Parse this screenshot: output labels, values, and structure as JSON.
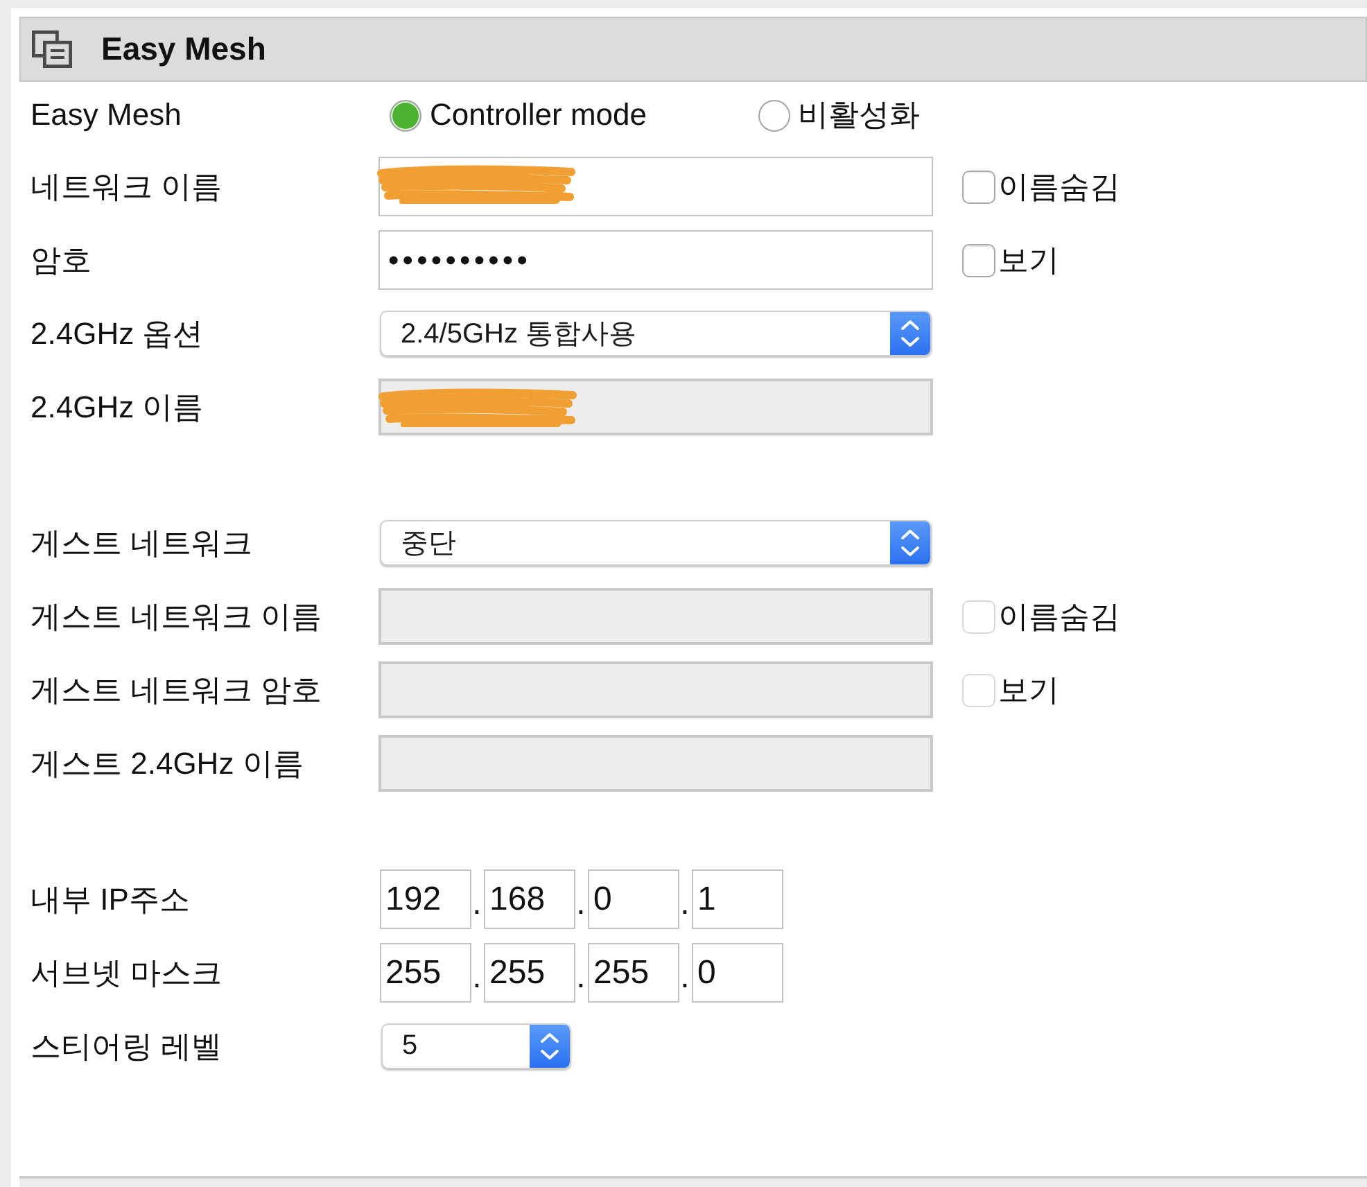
{
  "panel": {
    "title": "Easy Mesh"
  },
  "sections": [
    {
      "rows": [
        {
          "kind": "radio",
          "label": "Easy Mesh",
          "options": [
            {
              "label": "Controller mode",
              "selected": true
            },
            {
              "label": "비활성화",
              "selected": false
            }
          ]
        },
        {
          "kind": "text",
          "label": "네트워크 이름",
          "disabled": false,
          "redacted": true,
          "checkbox": {
            "label": "이름숨김",
            "checked": false,
            "disabled": false
          }
        },
        {
          "kind": "password",
          "label": "암호",
          "value": "••••••••••",
          "disabled": false,
          "checkbox": {
            "label": "보기",
            "checked": false,
            "disabled": false
          }
        },
        {
          "kind": "select",
          "label": "2.4GHz 옵션",
          "value": "2.4/5GHz 통합사용"
        },
        {
          "kind": "text",
          "label": "2.4GHz 이름",
          "disabled": true,
          "redacted": true
        }
      ]
    },
    {
      "rows": [
        {
          "kind": "select",
          "label": "게스트 네트워크",
          "value": "중단"
        },
        {
          "kind": "text",
          "label": "게스트 네트워크 이름",
          "disabled": true,
          "checkbox": {
            "label": "이름숨김",
            "checked": false,
            "disabled": true
          }
        },
        {
          "kind": "password",
          "label": "게스트 네트워크 암호",
          "disabled": true,
          "checkbox": {
            "label": "보기",
            "checked": false,
            "disabled": true
          }
        },
        {
          "kind": "text",
          "label": "게스트 2.4GHz 이름",
          "disabled": true
        }
      ]
    },
    {
      "rows": [
        {
          "kind": "ip",
          "label": "내부 IP주소",
          "octets": [
            {
              "value": "192"
            },
            {
              "separator": ".",
              "value": "168"
            },
            {
              "separator": ".",
              "value": "0"
            },
            {
              "separator": ".",
              "value": "1"
            }
          ]
        },
        {
          "kind": "ip",
          "label": "서브넷 마스크",
          "octets": [
            {
              "value": "255"
            },
            {
              "separator": ".",
              "value": "255"
            },
            {
              "separator": ".",
              "value": "255"
            },
            {
              "separator": ".",
              "value": "0"
            }
          ]
        },
        {
          "kind": "select",
          "label": "스티어링 레벨",
          "value": "5"
        }
      ]
    }
  ]
}
